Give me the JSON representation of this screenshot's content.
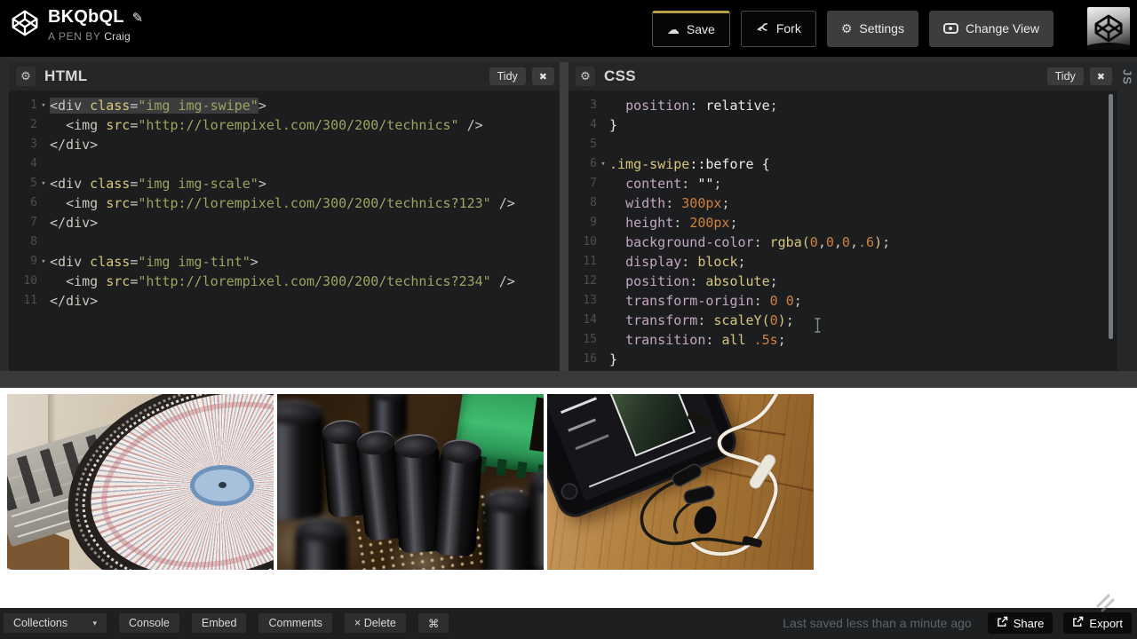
{
  "colors": {
    "accent_gold": "#b99f45",
    "editor_bg": "#1c1d1e",
    "panel_head_bg": "#252627",
    "gutter_num": "#4e4e4e",
    "sel_bg": "#3a3c3d",
    "tk_t": "#c5c9bc",
    "tk_a": "#d8c57e",
    "tk_s": "#9aa55f",
    "tk_p": "#c2a7c2",
    "tk_n": "#d0813d",
    "tk_d": "#c9c9c2",
    "tk_w": "#ecebe4"
  },
  "header": {
    "logo_icon": "codepen-cube-icon",
    "title": "BKQbQL",
    "edit_icon_glyph": "✎",
    "byline_prefix": "A PEN BY",
    "author": "Craig",
    "buttons": {
      "save": {
        "label": "Save",
        "icon": "cloud-icon",
        "icon_glyph": "☁"
      },
      "fork": {
        "label": "Fork",
        "icon": "fork-icon"
      },
      "settings": {
        "label": "Settings",
        "icon": "gear-icon",
        "icon_glyph": "⚙"
      },
      "change_view": {
        "label": "Change View",
        "icon": "eye-icon"
      }
    },
    "avatar_icon": "codepen-cube-avatar"
  },
  "editors": {
    "html": {
      "title": "HTML",
      "gear_glyph": "⚙",
      "tidy_label": "Tidy",
      "close_glyph": "✖",
      "lines": [
        {
          "n": 1,
          "fold": true,
          "tokens": [
            [
              "t sel",
              "<div "
            ],
            [
              "a sel",
              "class"
            ],
            [
              "d sel",
              "="
            ],
            [
              "s sel",
              "\"img img-swipe\""
            ],
            [
              "t",
              ">"
            ]
          ]
        },
        {
          "n": 2,
          "tokens": [
            [
              "d",
              "  "
            ],
            [
              "t",
              "<img "
            ],
            [
              "a",
              "src"
            ],
            [
              "d",
              "="
            ],
            [
              "s",
              "\"http://lorempixel.com/300/200/technics\""
            ],
            [
              "t",
              " />"
            ]
          ]
        },
        {
          "n": 3,
          "tokens": [
            [
              "t",
              "</div>"
            ]
          ]
        },
        {
          "n": 4,
          "tokens": []
        },
        {
          "n": 5,
          "fold": true,
          "tokens": [
            [
              "t",
              "<div "
            ],
            [
              "a",
              "class"
            ],
            [
              "d",
              "="
            ],
            [
              "s",
              "\"img img-scale\""
            ],
            [
              "t",
              ">"
            ]
          ]
        },
        {
          "n": 6,
          "tokens": [
            [
              "d",
              "  "
            ],
            [
              "t",
              "<img "
            ],
            [
              "a",
              "src"
            ],
            [
              "d",
              "="
            ],
            [
              "s",
              "\"http://lorempixel.com/300/200/technics?123\""
            ],
            [
              "t",
              " />"
            ]
          ]
        },
        {
          "n": 7,
          "tokens": [
            [
              "t",
              "</div>"
            ]
          ]
        },
        {
          "n": 8,
          "tokens": []
        },
        {
          "n": 9,
          "fold": true,
          "tokens": [
            [
              "t",
              "<div "
            ],
            [
              "a",
              "class"
            ],
            [
              "d",
              "="
            ],
            [
              "s",
              "\"img img-tint\""
            ],
            [
              "t",
              ">"
            ]
          ]
        },
        {
          "n": 10,
          "tokens": [
            [
              "d",
              "  "
            ],
            [
              "t",
              "<img "
            ],
            [
              "a",
              "src"
            ],
            [
              "d",
              "="
            ],
            [
              "s",
              "\"http://lorempixel.com/300/200/technics?234\""
            ],
            [
              "t",
              " />"
            ]
          ]
        },
        {
          "n": 11,
          "tokens": [
            [
              "t",
              "</div>"
            ]
          ]
        }
      ]
    },
    "css": {
      "title": "CSS",
      "gear_glyph": "⚙",
      "tidy_label": "Tidy",
      "close_glyph": "✖",
      "lines": [
        {
          "n": 3,
          "tokens": [
            [
              "d",
              "  "
            ],
            [
              "p",
              "position"
            ],
            [
              "d",
              ": "
            ],
            [
              "w",
              "relative"
            ],
            [
              "d",
              ";"
            ]
          ]
        },
        {
          "n": 4,
          "tokens": [
            [
              "w",
              "}"
            ]
          ]
        },
        {
          "n": 5,
          "tokens": []
        },
        {
          "n": 6,
          "fold": true,
          "tokens": [
            [
              "a",
              ".img-swipe"
            ],
            [
              "w",
              "::before {"
            ]
          ]
        },
        {
          "n": 7,
          "tokens": [
            [
              "d",
              "  "
            ],
            [
              "p",
              "content"
            ],
            [
              "d",
              ": "
            ],
            [
              "w",
              "\"\""
            ],
            [
              "d",
              ";"
            ]
          ]
        },
        {
          "n": 8,
          "tokens": [
            [
              "d",
              "  "
            ],
            [
              "p",
              "width"
            ],
            [
              "d",
              ": "
            ],
            [
              "n",
              "300px"
            ],
            [
              "d",
              ";"
            ]
          ]
        },
        {
          "n": 9,
          "tokens": [
            [
              "d",
              "  "
            ],
            [
              "p",
              "height"
            ],
            [
              "d",
              ": "
            ],
            [
              "n",
              "200px"
            ],
            [
              "d",
              ";"
            ]
          ]
        },
        {
          "n": 10,
          "tokens": [
            [
              "d",
              "  "
            ],
            [
              "p",
              "background-color"
            ],
            [
              "d",
              ": "
            ],
            [
              "a",
              "rgba("
            ],
            [
              "n",
              "0"
            ],
            [
              "d",
              ","
            ],
            [
              "n",
              "0"
            ],
            [
              "d",
              ","
            ],
            [
              "n",
              "0"
            ],
            [
              "d",
              ","
            ],
            [
              "n",
              ".6"
            ],
            [
              "a",
              ")"
            ],
            [
              "d",
              ";"
            ]
          ]
        },
        {
          "n": 11,
          "tokens": [
            [
              "d",
              "  "
            ],
            [
              "p",
              "display"
            ],
            [
              "d",
              ": "
            ],
            [
              "a",
              "block"
            ],
            [
              "d",
              ";"
            ]
          ]
        },
        {
          "n": 12,
          "tokens": [
            [
              "d",
              "  "
            ],
            [
              "p",
              "position"
            ],
            [
              "d",
              ": "
            ],
            [
              "a",
              "absolute"
            ],
            [
              "d",
              ";"
            ]
          ]
        },
        {
          "n": 13,
          "tokens": [
            [
              "d",
              "  "
            ],
            [
              "p",
              "transform-origin"
            ],
            [
              "d",
              ": "
            ],
            [
              "n",
              "0"
            ],
            [
              "d",
              " "
            ],
            [
              "n",
              "0"
            ],
            [
              "d",
              ";"
            ]
          ]
        },
        {
          "n": 14,
          "tokens": [
            [
              "d",
              "  "
            ],
            [
              "p",
              "transform"
            ],
            [
              "d",
              ": "
            ],
            [
              "a",
              "scaleY("
            ],
            [
              "n",
              "0"
            ],
            [
              "a",
              ")"
            ],
            [
              "d",
              ";"
            ]
          ]
        },
        {
          "n": 15,
          "tokens": [
            [
              "d",
              "  "
            ],
            [
              "p",
              "transition"
            ],
            [
              "d",
              ": "
            ],
            [
              "a",
              "all"
            ],
            [
              "d",
              " "
            ],
            [
              "n",
              ".5s"
            ],
            [
              "d",
              ";"
            ]
          ]
        },
        {
          "n": 16,
          "tokens": [
            [
              "w",
              "}"
            ]
          ]
        }
      ]
    },
    "js_collapsed_label": "JS"
  },
  "preview": {
    "images": [
      {
        "name": "turntable-slipmat-photo"
      },
      {
        "name": "circuit-board-capacitors-photo"
      },
      {
        "name": "phone-earbuds-photo"
      }
    ]
  },
  "footer": {
    "collections_label": "Collections",
    "collections_caret_glyph": "▾",
    "console_label": "Console",
    "embed_label": "Embed",
    "comments_label": "Comments",
    "delete_label": "× Delete",
    "command_label": "⌘",
    "status": "Last saved less than a minute ago",
    "share_label": "Share",
    "export_label": "Export"
  }
}
